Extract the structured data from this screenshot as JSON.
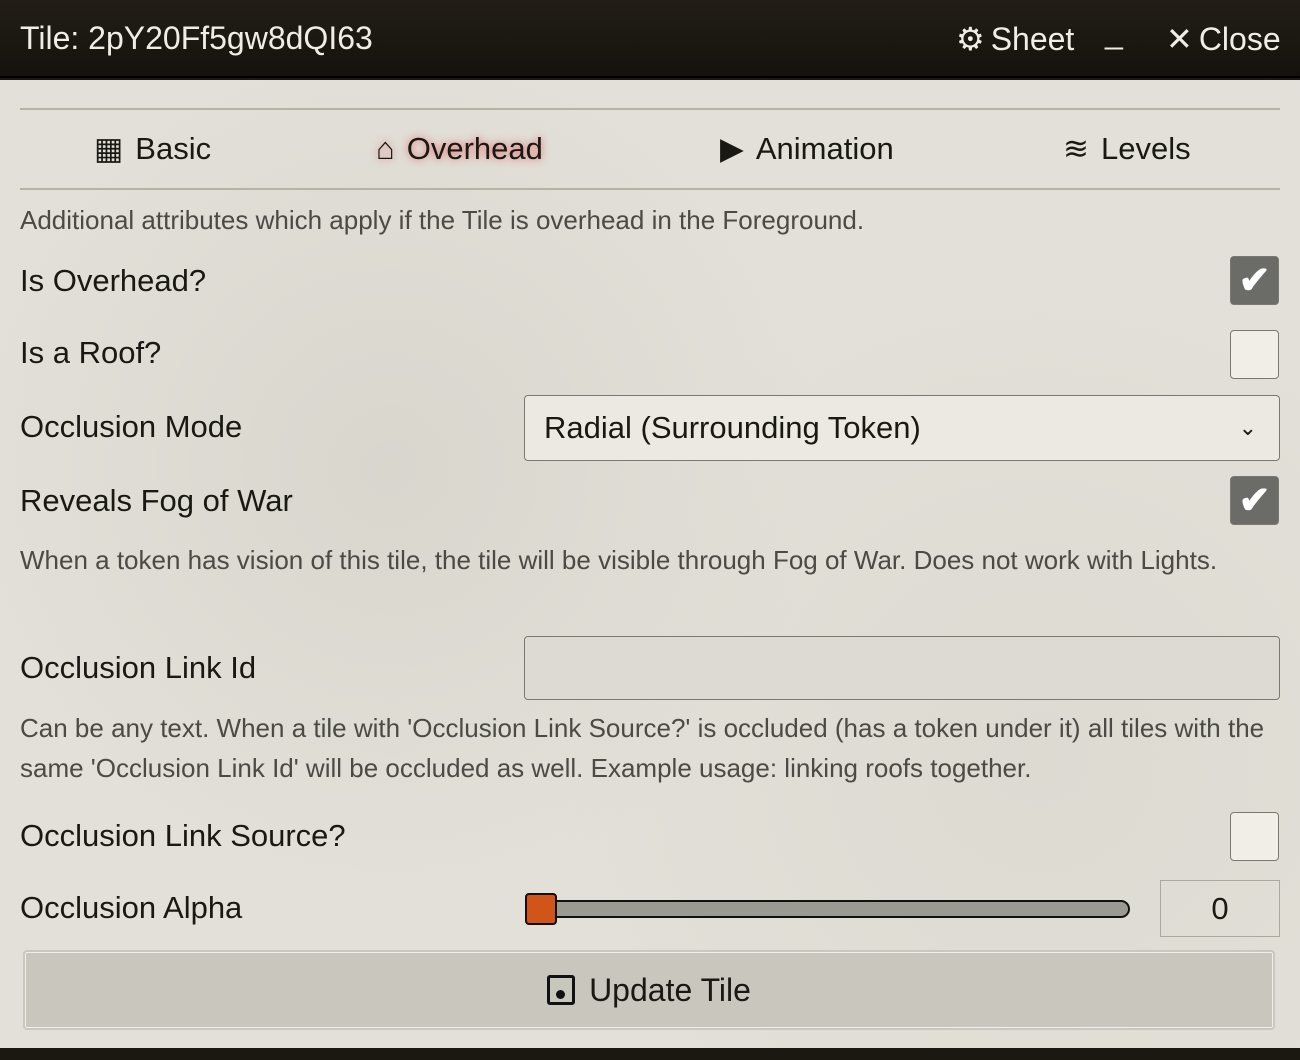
{
  "window": {
    "title": "Tile: 2pY20Ff5gw8dQI63",
    "sheet_label": "Sheet",
    "minimize_label": "_",
    "close_label": "Close"
  },
  "tabs": [
    {
      "label": "Basic",
      "icon": "cubes-icon"
    },
    {
      "label": "Overhead",
      "icon": "home-icon",
      "active": true
    },
    {
      "label": "Animation",
      "icon": "play-icon"
    },
    {
      "label": "Levels",
      "icon": "layer-group-icon"
    }
  ],
  "description": "Additional attributes which apply if the Tile is overhead in the Foreground.",
  "fields": {
    "is_overhead": {
      "label": "Is Overhead?",
      "checked": true
    },
    "is_roof": {
      "label": "Is a Roof?",
      "checked": false
    },
    "occlusion_mode": {
      "label": "Occlusion Mode",
      "value": "Radial (Surrounding Token)"
    },
    "reveals_fog": {
      "label": "Reveals Fog of War",
      "checked": true,
      "hint": "When a token has vision of this tile, the tile will be visible through Fog of War. Does not work with Lights."
    },
    "link_id": {
      "label": "Occlusion Link Id",
      "value": "",
      "hint": "Can be any text. When a tile with 'Occlusion Link Source?' is occluded (has a token under it) all tiles with the same 'Occlusion Link Id' will be occluded as well. Example usage: linking roofs together."
    },
    "link_source": {
      "label": "Occlusion Link Source?",
      "checked": false
    },
    "alpha": {
      "label": "Occlusion Alpha",
      "value": "0"
    }
  },
  "submit_label": "Update Tile",
  "colors": {
    "accent": "#d15418",
    "header": "#1b1812"
  }
}
